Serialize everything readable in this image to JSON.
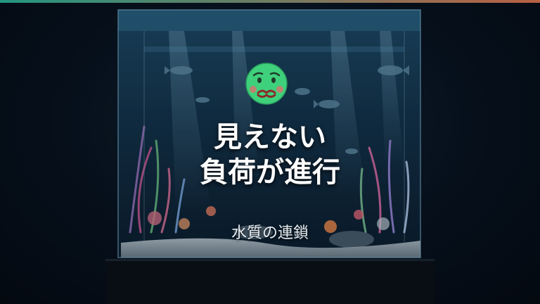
{
  "colors": {
    "accent_start": "#2bb59a",
    "accent_end": "#e2744f",
    "background": "#060d17",
    "title_text": "#ffffff",
    "emoji_face": "#3fd07c"
  },
  "icon": "nauseated-face-emoji",
  "headline": {
    "line1": "見えない",
    "line2": "負荷が進行"
  },
  "subtitle": "水質の連鎖"
}
